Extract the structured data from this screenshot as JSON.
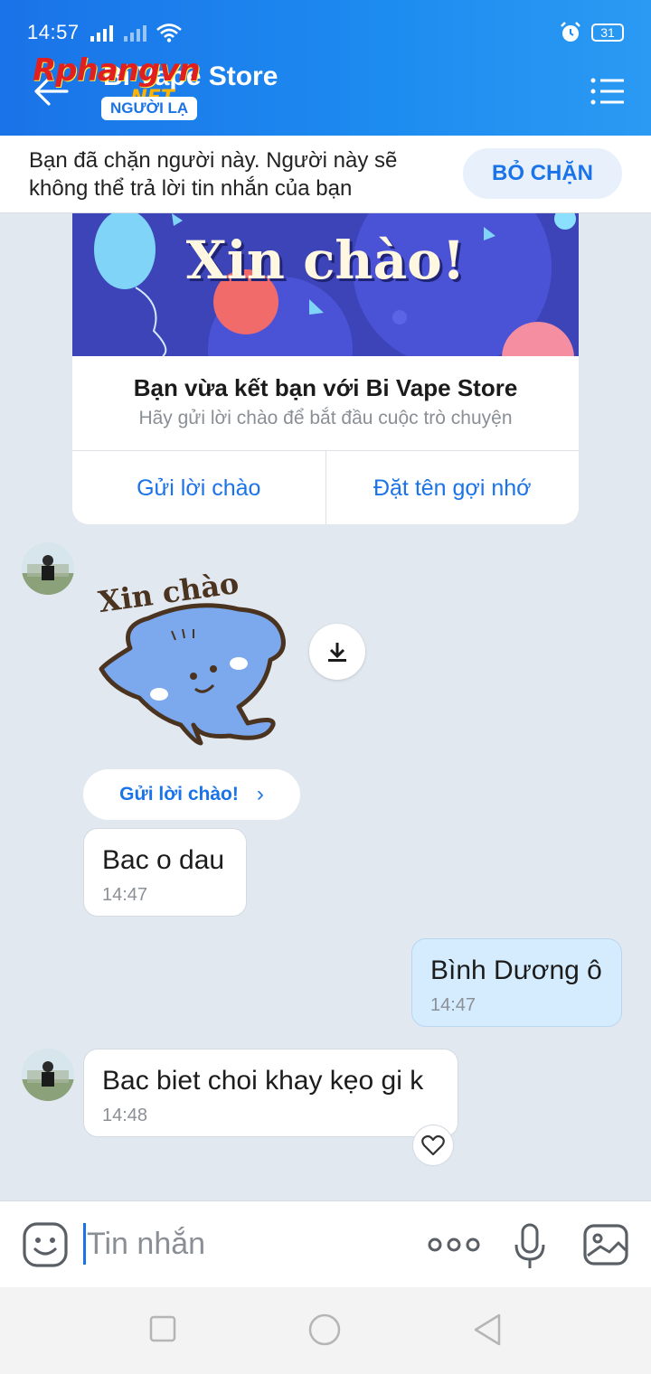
{
  "status_bar": {
    "time": "14:57",
    "battery": "31"
  },
  "header": {
    "logo_text": "Rphangvn",
    "logo_suffix": ".NET",
    "title": "Bi Vape Store",
    "badge": "NGƯỜI LẠ"
  },
  "block_banner": {
    "message": "Bạn đã chặn người này. Người này sẽ không thể trả lời tin nhắn của bạn",
    "unblock_label": "BỎ CHẶN"
  },
  "friend_card": {
    "banner_text": "Xin chào!",
    "title": "Bạn vừa kết bạn với Bi Vape Store",
    "subtitle": "Hãy gửi lời chào để bắt đầu cuộc trò chuyện",
    "action_greet": "Gửi lời chào",
    "action_nickname": "Đặt tên gợi nhớ"
  },
  "sticker": {
    "caption": "Xin chào"
  },
  "greet_button": {
    "label": "Gửi lời chào!"
  },
  "messages": [
    {
      "text": "Bac o dau",
      "time": "14:47",
      "from": "them"
    },
    {
      "text": "Bình Dương ô",
      "time": "14:47",
      "from": "me"
    },
    {
      "text": "Bac biet choi khay kẹo gi k",
      "time": "14:48",
      "from": "them"
    }
  ],
  "composer": {
    "placeholder": "Tin nhắn"
  },
  "colors": {
    "accent": "#1a73e8",
    "header_start": "#1a73e8",
    "my_bubble": "#d5ecfe",
    "chat_bg": "#e2e8f0"
  }
}
